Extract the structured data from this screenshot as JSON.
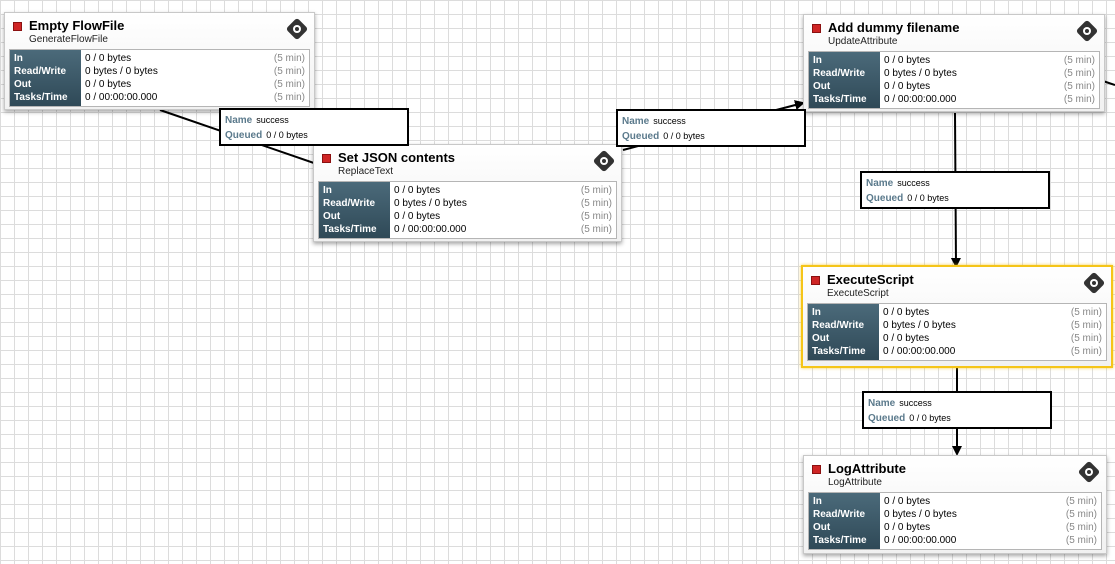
{
  "processors": [
    {
      "name": "Empty FlowFile",
      "type": "GenerateFlowFile",
      "stats": [
        {
          "label": "In",
          "value": "0 / 0 bytes",
          "time": "(5 min)"
        },
        {
          "label": "Read/Write",
          "value": "0 bytes / 0 bytes",
          "time": "(5 min)"
        },
        {
          "label": "Out",
          "value": "0 / 0 bytes",
          "time": "(5 min)"
        },
        {
          "label": "Tasks/Time",
          "value": "0 / 00:00:00.000",
          "time": "(5 min)"
        }
      ]
    },
    {
      "name": "Set JSON contents",
      "type": "ReplaceText",
      "stats": [
        {
          "label": "In",
          "value": "0 / 0 bytes",
          "time": "(5 min)"
        },
        {
          "label": "Read/Write",
          "value": "0 bytes / 0 bytes",
          "time": "(5 min)"
        },
        {
          "label": "Out",
          "value": "0 / 0 bytes",
          "time": "(5 min)"
        },
        {
          "label": "Tasks/Time",
          "value": "0 / 00:00:00.000",
          "time": "(5 min)"
        }
      ]
    },
    {
      "name": "Add dummy filename",
      "type": "UpdateAttribute",
      "stats": [
        {
          "label": "In",
          "value": "0 / 0 bytes",
          "time": "(5 min)"
        },
        {
          "label": "Read/Write",
          "value": "0 bytes / 0 bytes",
          "time": "(5 min)"
        },
        {
          "label": "Out",
          "value": "0 / 0 bytes",
          "time": "(5 min)"
        },
        {
          "label": "Tasks/Time",
          "value": "0 / 00:00:00.000",
          "time": "(5 min)"
        }
      ]
    },
    {
      "name": "ExecuteScript",
      "type": "ExecuteScript",
      "stats": [
        {
          "label": "In",
          "value": "0 / 0 bytes",
          "time": "(5 min)"
        },
        {
          "label": "Read/Write",
          "value": "0 bytes / 0 bytes",
          "time": "(5 min)"
        },
        {
          "label": "Out",
          "value": "0 / 0 bytes",
          "time": "(5 min)"
        },
        {
          "label": "Tasks/Time",
          "value": "0 / 00:00:00.000",
          "time": "(5 min)"
        }
      ]
    },
    {
      "name": "LogAttribute",
      "type": "LogAttribute",
      "stats": [
        {
          "label": "In",
          "value": "0 / 0 bytes",
          "time": "(5 min)"
        },
        {
          "label": "Read/Write",
          "value": "0 bytes / 0 bytes",
          "time": "(5 min)"
        },
        {
          "label": "Out",
          "value": "0 / 0 bytes",
          "time": "(5 min)"
        },
        {
          "label": "Tasks/Time",
          "value": "0 / 00:00:00.000",
          "time": "(5 min)"
        }
      ]
    }
  ],
  "connections": [
    {
      "name_label": "Name",
      "name": "success",
      "queued_label": "Queued",
      "queued": "0 / 0 bytes"
    },
    {
      "name_label": "Name",
      "name": "success",
      "queued_label": "Queued",
      "queued": "0 / 0 bytes"
    },
    {
      "name_label": "Name",
      "name": "success",
      "queued_label": "Queued",
      "queued": "0 / 0 bytes"
    },
    {
      "name_label": "Name",
      "name": "success",
      "queued_label": "Queued",
      "queued": "0 / 0 bytes"
    }
  ],
  "colors": {
    "running_status": "#cf2525",
    "selection": "#f5c518",
    "stats_label_bg": "#3d5a6a",
    "connection_key": "#5b7a8c"
  },
  "icons": {
    "status": "stopped-square-icon",
    "processor": "processor-icon"
  }
}
